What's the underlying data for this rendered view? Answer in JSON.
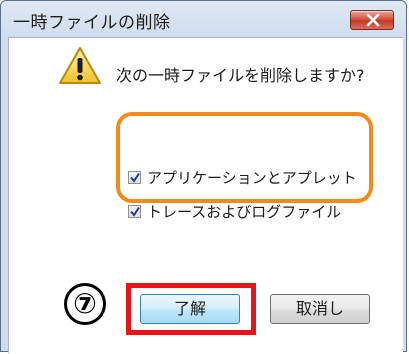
{
  "dialog": {
    "title": "一時ファイルの削除",
    "question": "次の一時ファイルを削除しますか?",
    "options": [
      {
        "label": "アプリケーションとアプレット",
        "checked": true
      },
      {
        "label": "トレースおよびログファイル",
        "checked": true
      }
    ],
    "ok_label": "了解",
    "cancel_label": "取消し"
  },
  "annotation": {
    "step_marker": "⑦"
  },
  "colors": {
    "highlight_orange": "#f28a1c",
    "highlight_red": "#e5141b",
    "close_button": "#c13a25"
  },
  "icons": {
    "close": "close-icon",
    "warning": "warning-icon",
    "check": "checkmark-icon"
  }
}
